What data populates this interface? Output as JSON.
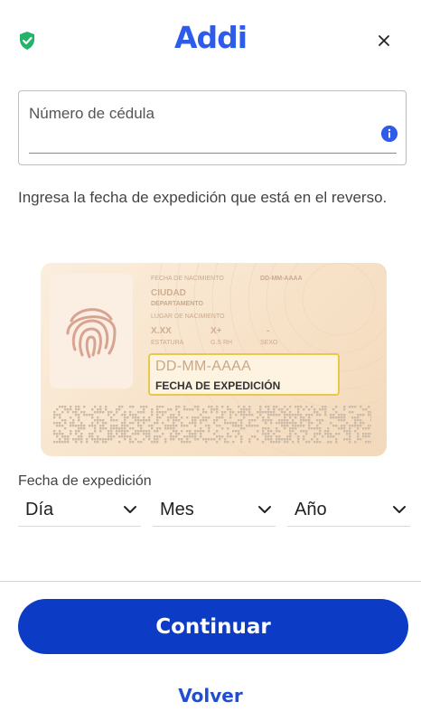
{
  "header": {
    "logo_text": "Addi",
    "brand_color": "#2d5bea",
    "shield_color": "#24b36b",
    "left_icon": "shield-check-icon",
    "close_icon": "close-icon"
  },
  "id_field": {
    "label": "Número de cédula",
    "value": "",
    "info_icon": "info-icon"
  },
  "instruction": "Ingresa la fecha de expedición que está en el reverso.",
  "id_card": {
    "birth_date_label": "FECHA DE NACIMIENTO",
    "birth_date_value": "DD-MM-AAAA",
    "city": "CIUDAD",
    "department": "DEPARTAMENTO",
    "birth_place_label": "LUGAR DE NACIMIENTO",
    "height_value": "X.XX",
    "blood_value": "X+",
    "sex_value": "-",
    "height_label": "ESTATURA",
    "blood_label": "G.S RH",
    "sex_label": "SEXO",
    "expedition_date": "DD-MM-AAAA",
    "expedition_label": "FECHA DE EXPEDICIÓN",
    "highlight_color": "#e8c74a"
  },
  "expedition": {
    "title": "Fecha de expedición",
    "day": "Día",
    "month": "Mes",
    "year": "Año"
  },
  "actions": {
    "continue": "Continuar",
    "back": "Volver",
    "primary_color": "#0c3bc5"
  }
}
